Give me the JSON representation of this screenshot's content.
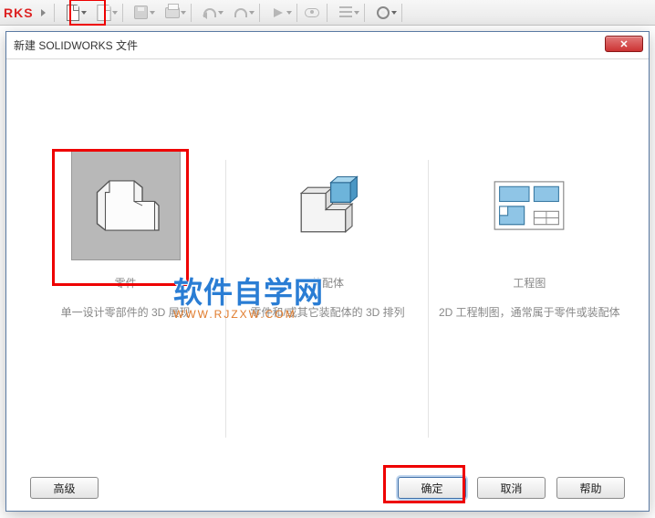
{
  "toolbar": {
    "logo_fragment": "RKS",
    "new_tooltip": "新建",
    "open_tooltip": "打开",
    "save_tooltip": "保存",
    "print_tooltip": "打印",
    "undo_tooltip": "撤销",
    "redo_tooltip": "重做",
    "select_tooltip": "选择",
    "rebuild_tooltip": "重建",
    "options_tooltip": "选项",
    "settings_tooltip": "设置"
  },
  "dialog": {
    "title": "新建 SOLIDWORKS 文件",
    "close_label": "✕"
  },
  "options": {
    "part": {
      "title": "零件",
      "desc": "单一设计零部件的 3D 展现"
    },
    "assembly": {
      "title": "装配体",
      "desc": "零件和/或其它装配体的 3D 排列"
    },
    "drawing": {
      "title": "工程图",
      "desc": "2D 工程制图，通常属于零件或装配体"
    }
  },
  "footer": {
    "advanced": "高级",
    "ok": "确定",
    "cancel": "取消",
    "help": "帮助"
  },
  "watermark": {
    "main": "软件自学网",
    "sub": "WWW.RJZXW.COM"
  },
  "colors": {
    "highlight": "#e00",
    "assembly_accent": "#3d8fc0"
  }
}
